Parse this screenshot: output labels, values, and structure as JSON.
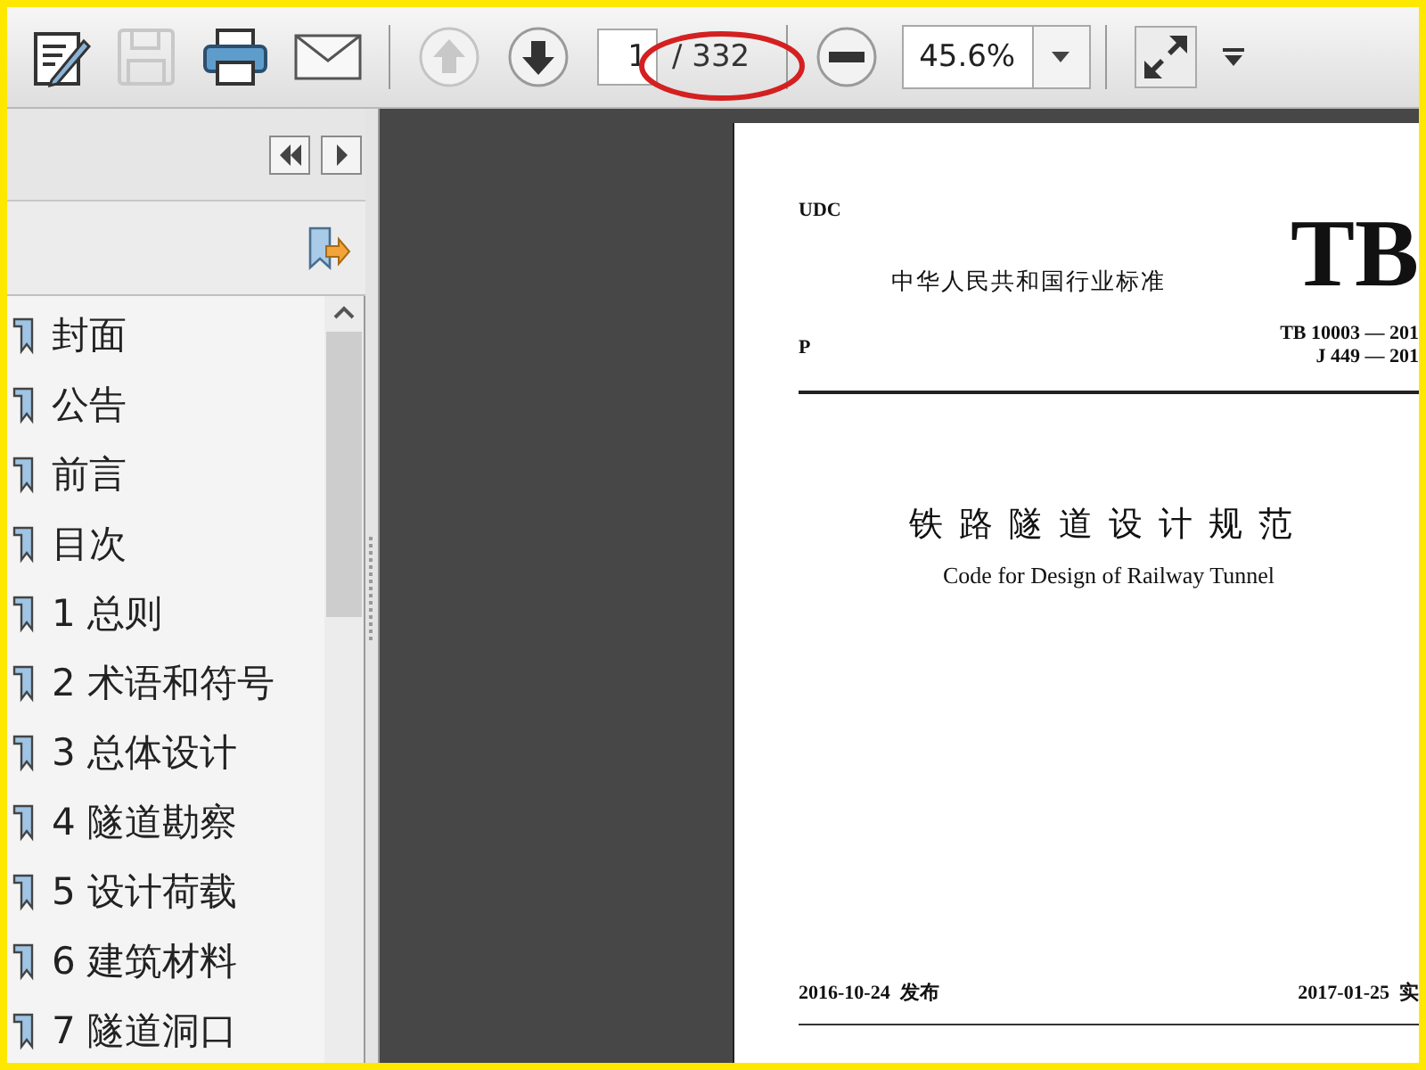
{
  "toolbar": {
    "save_button": {
      "disabled": true
    },
    "previous_page_button": {
      "disabled": true
    },
    "page_number": "1",
    "page_count": "/ 332",
    "zoom": "45.6%"
  },
  "bookmarks": [
    {
      "label": "封面"
    },
    {
      "label": "公告"
    },
    {
      "label": "前言"
    },
    {
      "label": "目次"
    },
    {
      "label": "1 总则"
    },
    {
      "label": "2 术语和符号"
    },
    {
      "label": "3 总体设计"
    },
    {
      "label": "4 隧道勘察"
    },
    {
      "label": "5 设计荷载"
    },
    {
      "label": "6 建筑材料"
    },
    {
      "label": "7 隧道洞口"
    }
  ],
  "document_page": {
    "udc": "UDC",
    "heading": "中华人民共和国行业标准",
    "class_mark": "P",
    "logo": "TB",
    "codes": [
      "TB 10003 — 201",
      "J 449 — 201"
    ],
    "title": "铁路隧道设计规范",
    "subtitle": "Code for Design of Railway Tunnel",
    "issued": "2016-10-24  发布",
    "effective": "2017-01-25  实"
  }
}
